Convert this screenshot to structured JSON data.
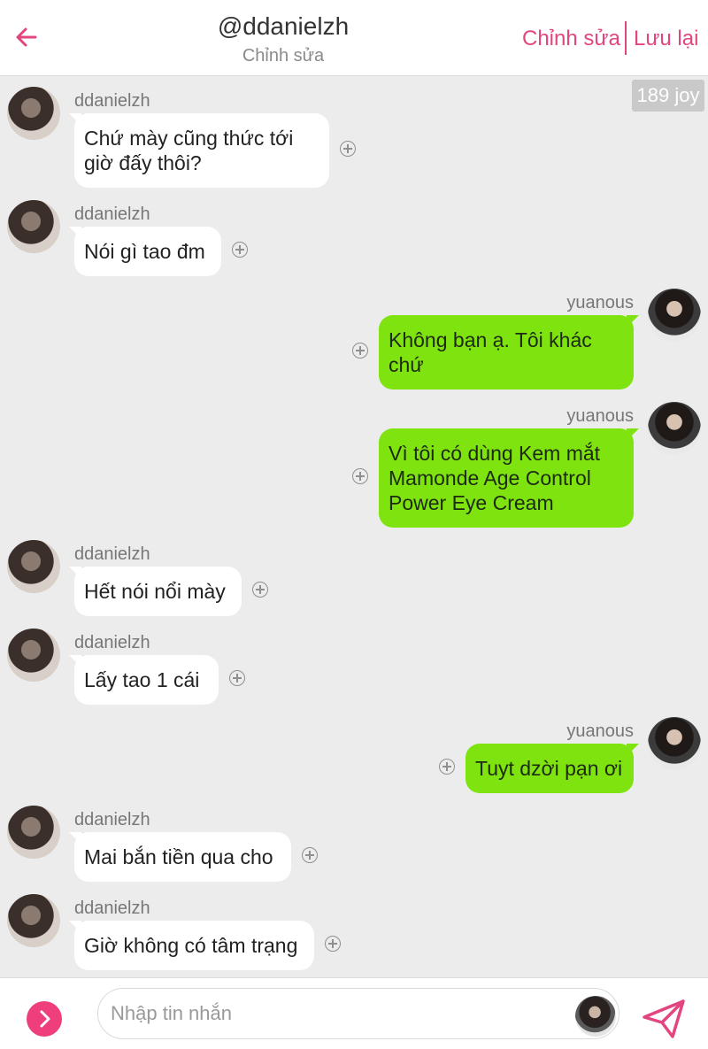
{
  "header": {
    "title": "@ddanielzh",
    "subtitle": "Chỉnh sửa",
    "edit_label": "Chỉnh sửa",
    "save_label": "Lưu lại",
    "accent_color": "#e2457f"
  },
  "joy_badge": "189 joy",
  "messages": [
    {
      "side": "left",
      "author": "ddanielzh",
      "text": "Chứ mày cũng thức tới giờ đấy thôi?"
    },
    {
      "side": "left",
      "author": "ddanielzh",
      "text": "Nói gì tao đm"
    },
    {
      "side": "right",
      "author": "yuanous",
      "text": "Không bạn ạ. Tôi khác chứ"
    },
    {
      "side": "right",
      "author": "yuanous",
      "text": "Vì tôi có dùng Kem mắt Mamonde Age Control Power Eye Cream"
    },
    {
      "side": "left",
      "author": "ddanielzh",
      "text": "Hết nói nổi mày"
    },
    {
      "side": "left",
      "author": "ddanielzh",
      "text": "Lấy tao 1 cái"
    },
    {
      "side": "right",
      "author": "yuanous",
      "text": "Tuyt dzời pạn ơi"
    },
    {
      "side": "left",
      "author": "ddanielzh",
      "text": "Mai bắn tiền qua cho"
    },
    {
      "side": "left",
      "author": "ddanielzh",
      "text": "Giờ không có tâm trạng"
    }
  ],
  "composer": {
    "placeholder": "Nhập tin nhắn",
    "value": ""
  },
  "icons": {
    "back": "arrow-left-icon",
    "add_reaction": "plus-circle-icon",
    "expand": "chevron-right-icon",
    "send": "paper-plane-icon"
  },
  "colors": {
    "bubble_outgoing": "#7fe30f",
    "bubble_incoming": "#ffffff",
    "background": "#ececec"
  }
}
